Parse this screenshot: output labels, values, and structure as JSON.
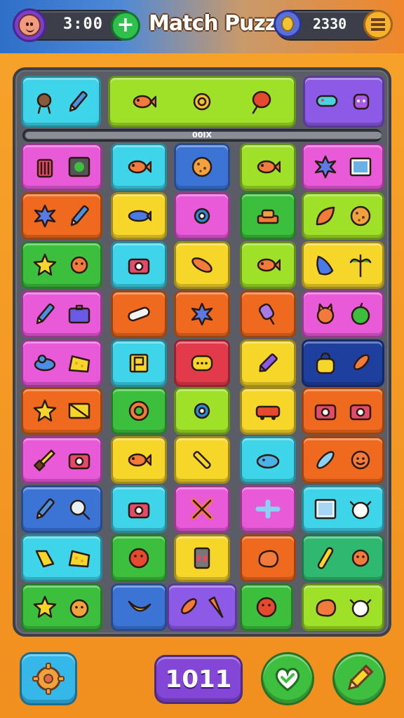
{
  "header": {
    "timer": "3:00",
    "title": "Match Puzzla",
    "coins": "2330"
  },
  "progress": {
    "label": "00IX"
  },
  "footer": {
    "score": "1011"
  },
  "colors": {
    "pink": "#e95ad9",
    "cyan": "#3ed4ea",
    "blue": "#3c74d6",
    "lime": "#9fe028",
    "orange": "#ef6a1e",
    "yellow": "#f7d62a",
    "green": "#3cbf3c",
    "red": "#e23a4a",
    "purple": "#8c5ae6",
    "navy": "#1f3f9e",
    "teal": "#2fb870"
  },
  "tiles": [
    {
      "color": "cyan",
      "icons": [
        "creature-icon",
        "pencil-icon"
      ]
    },
    {
      "color": "lime",
      "icons": [
        "fish-icon",
        "snail-icon",
        "balloon-icon"
      ]
    },
    {
      "color": "purple",
      "icons": [
        "shoe-icon",
        "robot-icon"
      ]
    },
    {
      "color": "pink",
      "icons": [
        "trash-can-icon",
        "tv-icon"
      ]
    },
    {
      "color": "cyan",
      "icons": [
        "fish-icon"
      ]
    },
    {
      "color": "blue",
      "icons": [
        "cookie-icon"
      ]
    },
    {
      "color": "lime",
      "icons": [
        "fish-icon"
      ]
    },
    {
      "color": "pink",
      "icons": [
        "splat-icon",
        "picture-icon"
      ]
    },
    {
      "color": "orange",
      "icons": [
        "splat-icon",
        "pencil-icon"
      ]
    },
    {
      "color": "yellow",
      "icons": [
        "shrimp-icon"
      ]
    },
    {
      "color": "pink",
      "icons": [
        "gear-icon"
      ]
    },
    {
      "color": "green",
      "icons": [
        "cake-icon"
      ]
    },
    {
      "color": "lime",
      "icons": [
        "leaf-icon",
        "cookie-icon"
      ]
    },
    {
      "color": "green",
      "icons": [
        "star-icon",
        "bug-icon"
      ]
    },
    {
      "color": "cyan",
      "icons": [
        "camera-icon"
      ]
    },
    {
      "color": "yellow",
      "icons": [
        "bread-icon"
      ]
    },
    {
      "color": "lime",
      "icons": [
        "fish-icon"
      ]
    },
    {
      "color": "yellow",
      "icons": [
        "glove-icon",
        "palm-tree-icon"
      ]
    },
    {
      "color": "pink",
      "icons": [
        "pencil-icon",
        "briefcase-icon"
      ]
    },
    {
      "color": "orange",
      "icons": [
        "hot-dog-icon"
      ]
    },
    {
      "color": "orange",
      "icons": [
        "splat-icon"
      ]
    },
    {
      "color": "orange",
      "icons": [
        "ice-cream-icon"
      ]
    },
    {
      "color": "pink",
      "icons": [
        "cat-icon",
        "apple-icon"
      ]
    },
    {
      "color": "pink",
      "icons": [
        "bird-icon",
        "cheese-icon"
      ]
    },
    {
      "color": "cyan",
      "icons": [
        "flag-icon"
      ]
    },
    {
      "color": "red",
      "icons": [
        "chat-icon"
      ]
    },
    {
      "color": "yellow",
      "icons": [
        "crayon-icon"
      ]
    },
    {
      "color": "navy",
      "icons": [
        "bag-icon",
        "rocket-icon"
      ]
    },
    {
      "color": "orange",
      "icons": [
        "star-icon",
        "envelope-icon"
      ]
    },
    {
      "color": "green",
      "icons": [
        "ring-icon"
      ]
    },
    {
      "color": "lime",
      "icons": [
        "gear-icon"
      ]
    },
    {
      "color": "yellow",
      "icons": [
        "car-icon"
      ]
    },
    {
      "color": "orange",
      "icons": [
        "camera-icon",
        "camera-icon"
      ]
    },
    {
      "color": "pink",
      "icons": [
        "brush-icon",
        "camera-icon"
      ]
    },
    {
      "color": "yellow",
      "icons": [
        "fish-icon"
      ]
    },
    {
      "color": "yellow",
      "icons": [
        "wrench-icon"
      ]
    },
    {
      "color": "cyan",
      "icons": [
        "slug-icon"
      ]
    },
    {
      "color": "orange",
      "icons": [
        "feather-icon",
        "face-icon"
      ]
    },
    {
      "color": "blue",
      "icons": [
        "pencil-icon",
        "magnifier-icon"
      ]
    },
    {
      "color": "cyan",
      "icons": [
        "camera-icon"
      ]
    },
    {
      "color": "pink",
      "icons": [
        "cross-icon"
      ]
    },
    {
      "color": "pink",
      "icons": [
        "plane-icon"
      ]
    },
    {
      "color": "cyan",
      "icons": [
        "frame-icon",
        "cow-icon"
      ]
    },
    {
      "color": "cyan",
      "icons": [
        "tag-icon",
        "cheese-icon"
      ]
    },
    {
      "color": "green",
      "icons": [
        "ball-icon"
      ]
    },
    {
      "color": "yellow",
      "icons": [
        "phone-icon"
      ]
    },
    {
      "color": "orange",
      "icons": [
        "blob-icon"
      ]
    },
    {
      "color": "teal",
      "icons": [
        "stick-icon",
        "bug-icon"
      ]
    },
    {
      "color": "green",
      "icons": [
        "star-icon",
        "pumpkin-icon"
      ]
    },
    {
      "color": "blue",
      "icons": [
        "banana-icon"
      ]
    },
    {
      "color": "purple",
      "icons": [
        "rocket-icon",
        "carrot-icon"
      ]
    },
    {
      "color": "green",
      "icons": [
        "ball-icon"
      ]
    },
    {
      "color": "lime",
      "icons": [
        "blob-icon",
        "cow-icon"
      ]
    }
  ]
}
